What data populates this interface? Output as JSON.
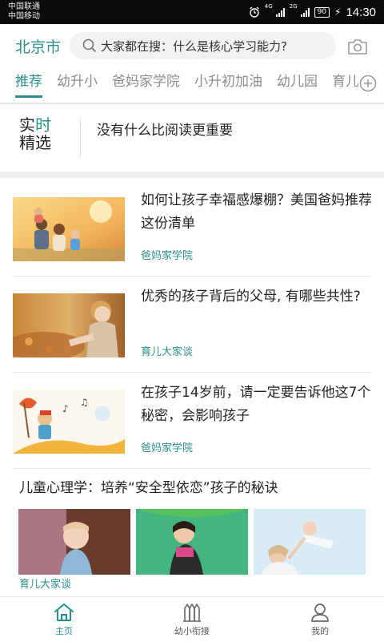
{
  "status_bar": {
    "carrier_1": "中国联通",
    "carrier_2": "中国移动",
    "network_1": "4G",
    "network_2": "2G",
    "battery": "90",
    "time": "14:30"
  },
  "header": {
    "city": "北京市",
    "search_placeholder": "大家都在搜：什么是核心学习能力?"
  },
  "tabs": [
    "推荐",
    "幼升小",
    "爸妈家学院",
    "小升初加油",
    "幼儿园",
    "育儿"
  ],
  "active_tab": 0,
  "live": {
    "badge_line1_a": "实",
    "badge_line1_b": "时",
    "badge_line2": "精选",
    "headline": "没有什么比阅读更重要"
  },
  "articles": [
    {
      "title": "如何让孩子幸福感爆棚？美国爸妈推荐这份清单",
      "source": "爸妈家学院",
      "image": "family-outdoor-photo"
    },
    {
      "title": "优秀的孩子背后的父母, 有哪些共性?",
      "source": "育儿大家谈",
      "image": "child-autumn-leaves-photo"
    },
    {
      "title": "在孩子14岁前，请一定要告诉他这7个秘密，会影响孩子",
      "source": "爸妈家学院",
      "image": "child-music-illustration"
    }
  ],
  "feature": {
    "title": "儿童心理学：培养“安全型依恋”孩子的秘诀",
    "source": "育儿大家谈",
    "images": [
      "baby-blue-dress-photo",
      "toddler-on-slide-photo",
      "mother-lifting-baby-photo"
    ]
  },
  "bottom_nav": [
    {
      "label": "主页",
      "icon": "home-icon",
      "active": true
    },
    {
      "label": "幼小衔接",
      "icon": "pencils-icon",
      "active": false
    },
    {
      "label": "我的",
      "icon": "profile-icon",
      "active": false
    }
  ],
  "colors": {
    "accent": "#2a8f8a"
  }
}
